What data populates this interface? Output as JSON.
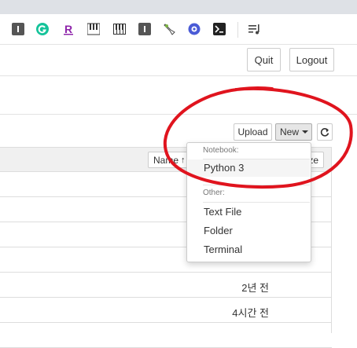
{
  "header": {
    "quit_label": "Quit",
    "logout_label": "Logout"
  },
  "toolbar": {
    "upload_label": "Upload",
    "new_label": "New"
  },
  "list": {
    "name_header": "Name",
    "size_header_partial": "ze",
    "rows": [
      {
        "modified": ""
      },
      {
        "modified": ""
      },
      {
        "modified": ""
      },
      {
        "modified": ""
      },
      {
        "modified": "2년 전"
      },
      {
        "modified": "4시간 전"
      }
    ]
  },
  "new_menu": {
    "notebook_header": "Notebook:",
    "notebook_items": [
      "Python 3"
    ],
    "other_header": "Other:",
    "other_items": [
      "Text File",
      "Folder",
      "Terminal"
    ]
  },
  "extensions": [
    "i-icon",
    "grammarly-icon",
    "r-icon",
    "piano-icon",
    "piano-icon",
    "i-icon",
    "mouse-icon",
    "pin-icon",
    "terminal-icon",
    "playlist-icon"
  ],
  "colors": {
    "annotation": "#e0141e",
    "new_button_bg": "#e6e6e6",
    "menu_active": "#f5f5f5"
  }
}
